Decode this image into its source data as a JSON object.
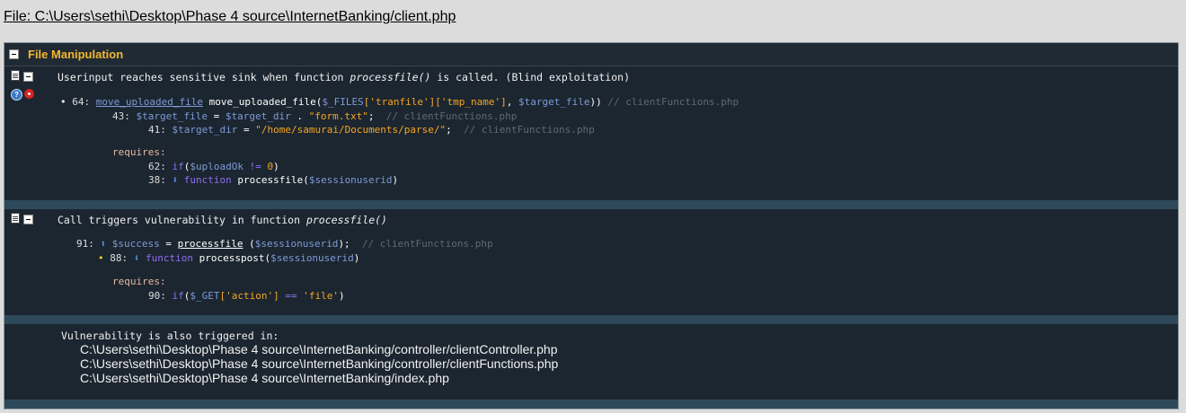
{
  "file_title": "File: C:\\Users\\sethi\\Desktop\\Phase 4 source\\InternetBanking/client.php",
  "panel": {
    "title": "File Manipulation"
  },
  "vuln1": {
    "desc_before": "Userinput reaches sensitive sink when function ",
    "desc_func": "processfile()",
    "desc_after": " is called. (Blind exploitation)",
    "l64": {
      "num": "64:",
      "link": "move_uploaded_file",
      "call": "move_uploaded_file(",
      "var1": "$_FILES",
      "s1": "['tranfile']",
      "s2": "['tmp_name']",
      "comma": ", ",
      "var2": "$target_file",
      "close": "))",
      "comment": "// clientFunctions.php"
    },
    "l43": {
      "num": "43:",
      "var1": "$target_file",
      "eq": " = ",
      "var2": "$target_dir",
      "dot": " . ",
      "str": "\"form.txt\"",
      "semi": ";",
      "comment": "// clientFunctions.php"
    },
    "l41": {
      "num": "41:",
      "var": "$target_dir",
      "eq": " = ",
      "str": "\"/home/samurai/Documents/parse/\"",
      "semi": ";",
      "comment": "// clientFunctions.php"
    },
    "requires": "requires:",
    "l62": {
      "num": "62:",
      "kw": "if",
      "open": "(",
      "var": "$uploadOk",
      "op": " != ",
      "val": "0",
      "close": ")"
    },
    "l38": {
      "num": "38:",
      "arrow": "⬇",
      "kw": "function",
      "name": " processfile(",
      "var": "$sessionuserid",
      "close": ")"
    }
  },
  "vuln2": {
    "desc_before": "Call triggers vulnerability in function ",
    "desc_func": "processfile()",
    "l91": {
      "num": "91:",
      "arrow": "⬆",
      "var": "$success",
      "eq": " = ",
      "link": "processfile",
      "open": " (",
      "arg": "$sessionuserid",
      "close": ");",
      "comment": "// clientFunctions.php"
    },
    "l88": {
      "num": "88:",
      "arrow": "⬇",
      "kw": "function",
      "name": " processpost(",
      "var": "$sessionuserid",
      "close": ")"
    },
    "requires": "requires:",
    "l90": {
      "num": "90:",
      "kw": "if",
      "open": "(",
      "var": "$_GET",
      "s1": "['action']",
      "op": " == ",
      "s2": "'file'",
      "close": ")"
    }
  },
  "also": {
    "label": "Vulnerability is also triggered in:",
    "paths": [
      "C:\\Users\\sethi\\Desktop\\Phase 4 source\\InternetBanking/controller/clientController.php",
      "C:\\Users\\sethi\\Desktop\\Phase 4 source\\InternetBanking/controller/clientFunctions.php",
      "C:\\Users\\sethi\\Desktop\\Phase 4 source\\InternetBanking/index.php"
    ]
  },
  "icons": {
    "collapse": "minus-icon",
    "document": "document-icon",
    "help": "help-icon",
    "exploit": "target-icon"
  }
}
